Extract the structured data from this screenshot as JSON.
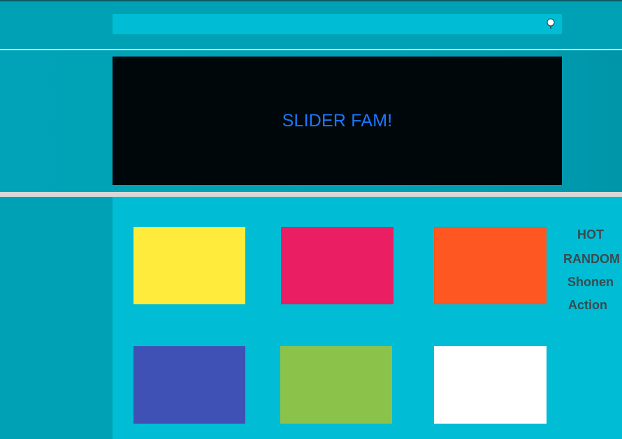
{
  "slider": {
    "title": "SLIDER FAM!",
    "text_color": "#1a78ff",
    "background": "#00070b"
  },
  "categories": {
    "items": [
      {
        "label": "HOT"
      },
      {
        "label": "RANDOM"
      },
      {
        "label": "Shonen"
      },
      {
        "label": "Action"
      }
    ]
  },
  "tiles": [
    {
      "color": "#ffeb3b"
    },
    {
      "color": "#e91e63"
    },
    {
      "color": "#ff5722"
    },
    {
      "color": "#3f51b5"
    },
    {
      "color": "#8bc34a"
    },
    {
      "color": "#ffffff"
    }
  ],
  "theme": {
    "page_bg": "#00a1b5",
    "content_bg": "#00bcd4",
    "search_bg": "#00bcd4",
    "divider_thick": "#d7d7d7"
  },
  "icons": {
    "search": "search-icon"
  }
}
